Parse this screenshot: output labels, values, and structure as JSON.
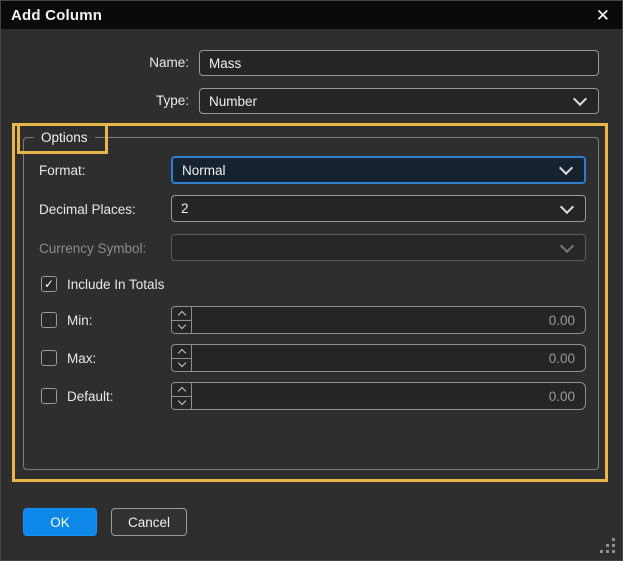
{
  "window": {
    "title": "Add Column"
  },
  "icons": {
    "close": "✕",
    "check": "✓"
  },
  "fields": {
    "name": {
      "label": "Name:",
      "value": "Mass"
    },
    "type": {
      "label": "Type:",
      "value": "Number"
    }
  },
  "options": {
    "legend": "Options",
    "format": {
      "label": "Format:",
      "value": "Normal",
      "focused": true
    },
    "decimal_places": {
      "label": "Decimal Places:",
      "value": "2"
    },
    "currency_symbol": {
      "label": "Currency Symbol:",
      "value": "",
      "disabled": true
    },
    "include_in_totals": {
      "label": "Include In Totals",
      "checked": true
    },
    "min": {
      "label": "Min:",
      "value": "0.00",
      "checked": false
    },
    "max": {
      "label": "Max:",
      "value": "0.00",
      "checked": false
    },
    "default": {
      "label": "Default:",
      "value": "0.00",
      "checked": false
    }
  },
  "buttons": {
    "ok": "OK",
    "cancel": "Cancel"
  },
  "colors": {
    "annotation_highlight": "#E9B64A",
    "accent_blue": "#0D87E8",
    "focus_border": "#2E7FD0",
    "titlebar_bg": "#0A0A0A",
    "dialog_bg": "#2E2E2E"
  }
}
